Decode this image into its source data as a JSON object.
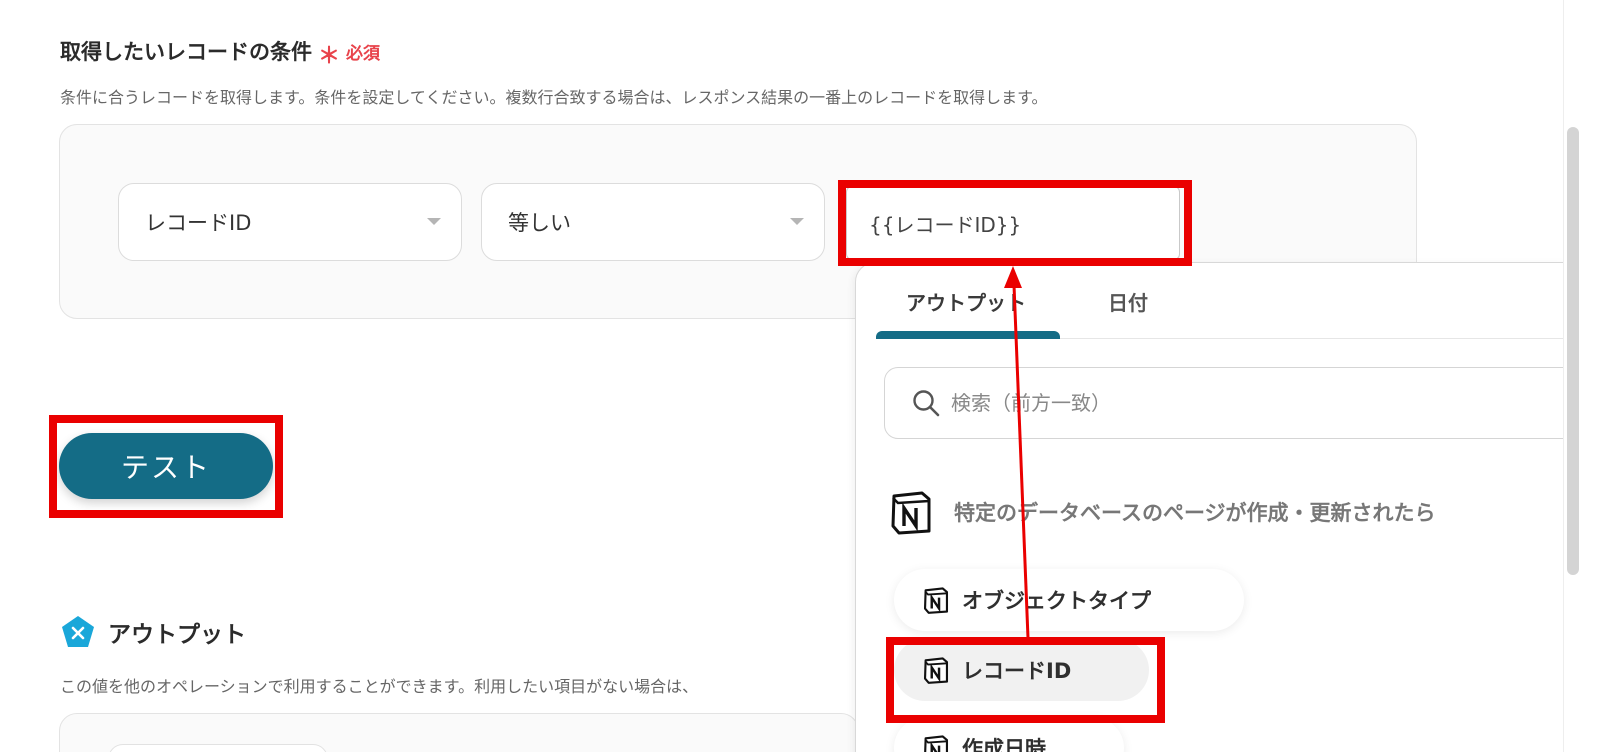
{
  "condition": {
    "title": "取得したいレコードの条件",
    "required_mark": "＊",
    "required_text": "必須",
    "description": "条件に合うレコードを取得します。条件を設定してください。複数行合致する場合は、レスポンス結果の一番上のレコードを取得します。",
    "field_select": "レコードID",
    "operator_select": "等しい",
    "value_input": "{{レコードID}}"
  },
  "test_button": "テスト",
  "output": {
    "title": "アウトプット",
    "description": "この値を他のオペレーションで利用することができます。利用したい項目がない場合は、"
  },
  "dropdown": {
    "tabs": [
      "アウトプット",
      "日付"
    ],
    "search_placeholder": "検索（前方一致）",
    "trigger_label": "特定のデータベースのページが作成・更新されたら",
    "items": [
      "オブジェクトタイプ",
      "レコードID",
      "作成日時"
    ]
  },
  "colors": {
    "accent": "#146c86",
    "required": "#e8434b",
    "annotation": "#ea0000"
  },
  "icons": {
    "output": "pentagon-x-icon",
    "search": "search-icon",
    "notion": "notion-icon"
  }
}
